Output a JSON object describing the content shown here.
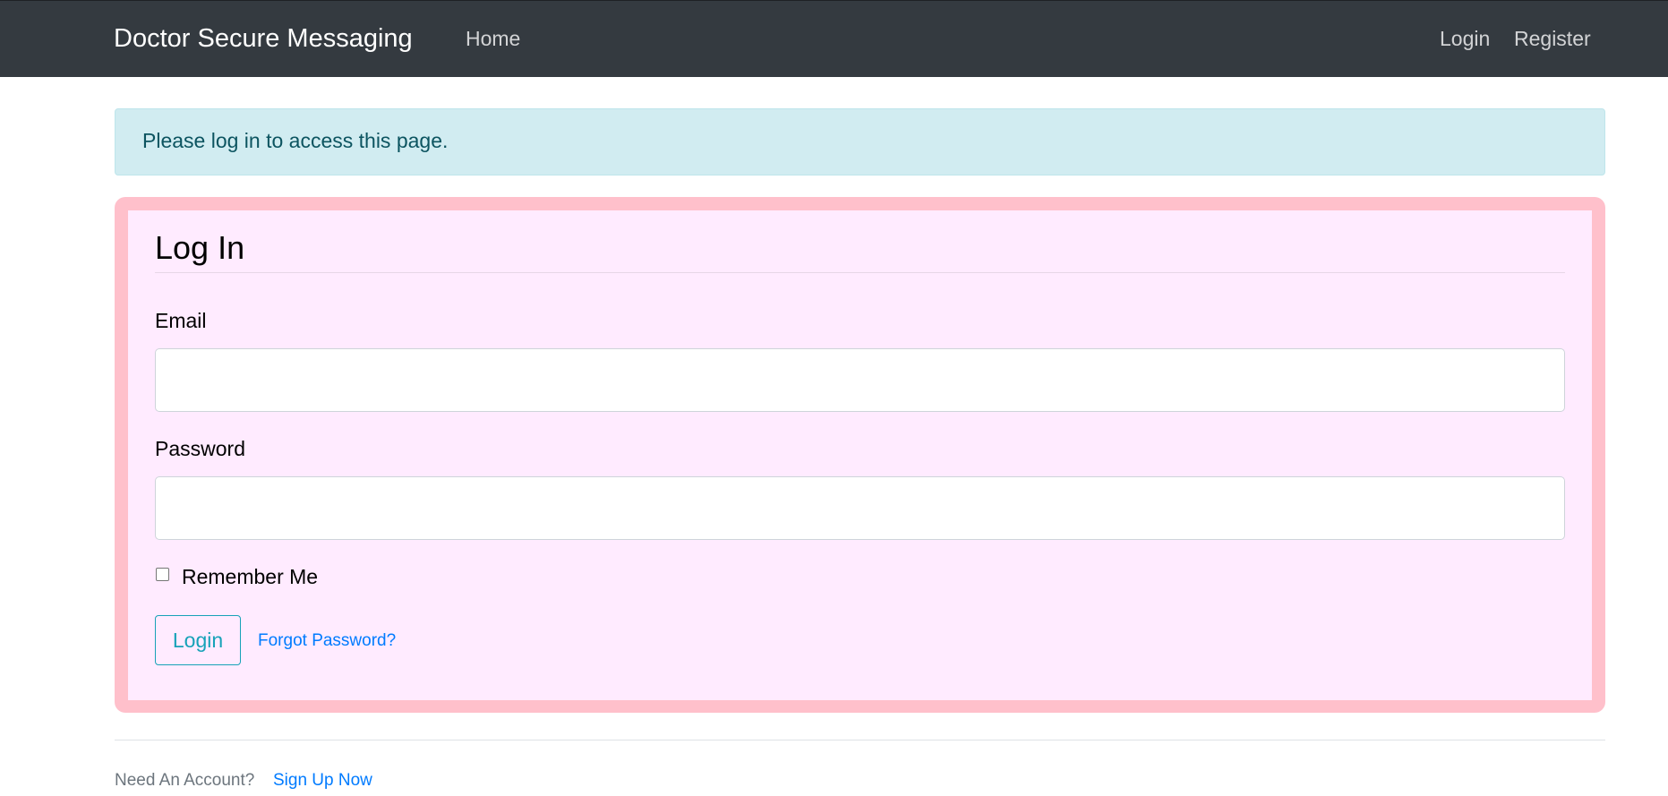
{
  "navbar": {
    "brand": "Doctor Secure Messaging",
    "home_label": "Home",
    "login_label": "Login",
    "register_label": "Register"
  },
  "alert": {
    "message": "Please log in to access this page."
  },
  "login_form": {
    "legend": "Log In",
    "email_label": "Email",
    "email_value": "",
    "password_label": "Password",
    "password_value": "",
    "remember_label": "Remember Me",
    "remember_checked": false,
    "submit_label": "Login",
    "forgot_label": "Forgot Password?"
  },
  "footer": {
    "prompt": "Need An Account?",
    "signup_label": "Sign Up Now"
  },
  "colors": {
    "navbar_bg": "#343a40",
    "alert_bg": "#d1ecf1",
    "alert_text": "#0c5460",
    "card_border": "#ffc0cb",
    "card_bg": "#ffebff",
    "button_outline": "#17a2b8",
    "link": "#007bff"
  }
}
